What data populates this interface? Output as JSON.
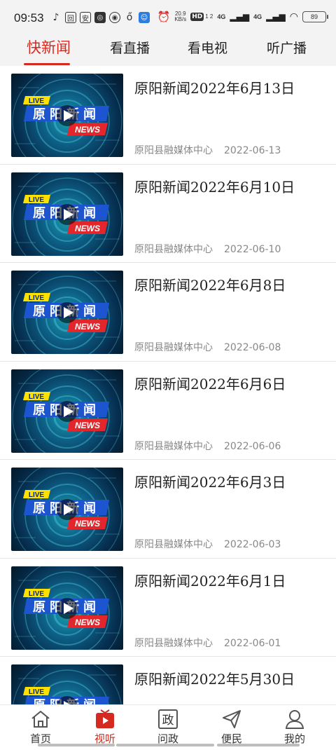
{
  "status_bar": {
    "time": "09:53",
    "left_icons": [
      "tiktok-icon",
      "app-icon-a",
      "app-icon-an",
      "app-icon-square",
      "app-icon-cat",
      "app-icon-weibo",
      "app-icon-blue"
    ],
    "net_speed_value": "20.9",
    "net_speed_unit": "KB/s",
    "hd_label": "HD",
    "hd_sub": "1 2",
    "signal1": "4G",
    "signal2": "4G",
    "battery": "89"
  },
  "tabs": [
    {
      "label": "快新闻",
      "active": true
    },
    {
      "label": "看直播",
      "active": false
    },
    {
      "label": "看电视",
      "active": false
    },
    {
      "label": "听广播",
      "active": false
    }
  ],
  "thumbnail": {
    "live_text": "LIVE",
    "banner_text": "原阳新闻",
    "news_text": "NEWS"
  },
  "news": [
    {
      "title": "原阳新闻2022年6月13日",
      "source": "原阳县融媒体中心",
      "date": "2022-06-13"
    },
    {
      "title": "原阳新闻2022年6月10日",
      "source": "原阳县融媒体中心",
      "date": "2022-06-10"
    },
    {
      "title": "原阳新闻2022年6月8日",
      "source": "原阳县融媒体中心",
      "date": "2022-06-08"
    },
    {
      "title": "原阳新闻2022年6月6日",
      "source": "原阳县融媒体中心",
      "date": "2022-06-06"
    },
    {
      "title": "原阳新闻2022年6月3日",
      "source": "原阳县融媒体中心",
      "date": "2022-06-03"
    },
    {
      "title": "原阳新闻2022年6月1日",
      "source": "原阳县融媒体中心",
      "date": "2022-06-01"
    },
    {
      "title": "原阳新闻2022年5月30日",
      "source": "",
      "date": ""
    }
  ],
  "bottom_nav": [
    {
      "label": "首页",
      "icon": "home-icon",
      "active": false
    },
    {
      "label": "视听",
      "icon": "video-icon",
      "active": true
    },
    {
      "label": "问政",
      "icon": "zheng-icon",
      "active": false
    },
    {
      "label": "便民",
      "icon": "send-icon",
      "active": false
    },
    {
      "label": "我的",
      "icon": "person-icon",
      "active": false
    }
  ],
  "colors": {
    "accent": "#d42a1f",
    "tab_bg": "#f3f3f3",
    "meta_text": "#888888"
  }
}
